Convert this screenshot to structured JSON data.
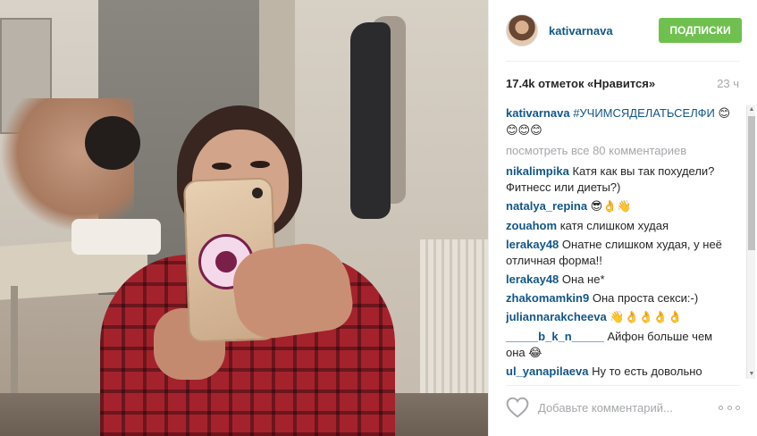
{
  "post": {
    "username": "kativarnava",
    "follow_label": "ПОДПИСКИ",
    "likes_text": "17.4k отметок «Нравится»",
    "age": "23 ч"
  },
  "caption": {
    "user": "kativarnava",
    "text": "#УЧИМСЯДЕЛАТЬСЕЛФИ",
    "emoji": "😊😊😊😊"
  },
  "view_all": "посмотреть все 80 комментариев",
  "comments": [
    {
      "user": "nikalimpika",
      "text": "Катя как вы так похудели? Фитнесс или диеты?)"
    },
    {
      "user": "natalya_repina",
      "text": "😎👌👋"
    },
    {
      "user": "zouahom",
      "text": "катя слишком худая"
    },
    {
      "user": "lerakay48",
      "text": "Онатне слишком худая, у неё отличная форма!!"
    },
    {
      "user": "lerakay48",
      "text": "Она не*"
    },
    {
      "user": "zhakomamkin9",
      "text": "Она проста секси:-)"
    },
    {
      "user": "juliannarakcheeva",
      "text": "👋👌👌👌👌"
    },
    {
      "user": "_____b_k_n_____",
      "text": "Айфон больше чем она 😂"
    },
    {
      "user": "ul_yanapilaeva",
      "text": "Ну то есть довольно"
    }
  ],
  "input": {
    "placeholder": "Добавьте комментарий..."
  },
  "icons": {
    "heart": "heart-icon",
    "more": "more-options-icon"
  },
  "colors": {
    "username": "#125688",
    "follow": "#70c050",
    "muted": "#a5a7aa"
  }
}
